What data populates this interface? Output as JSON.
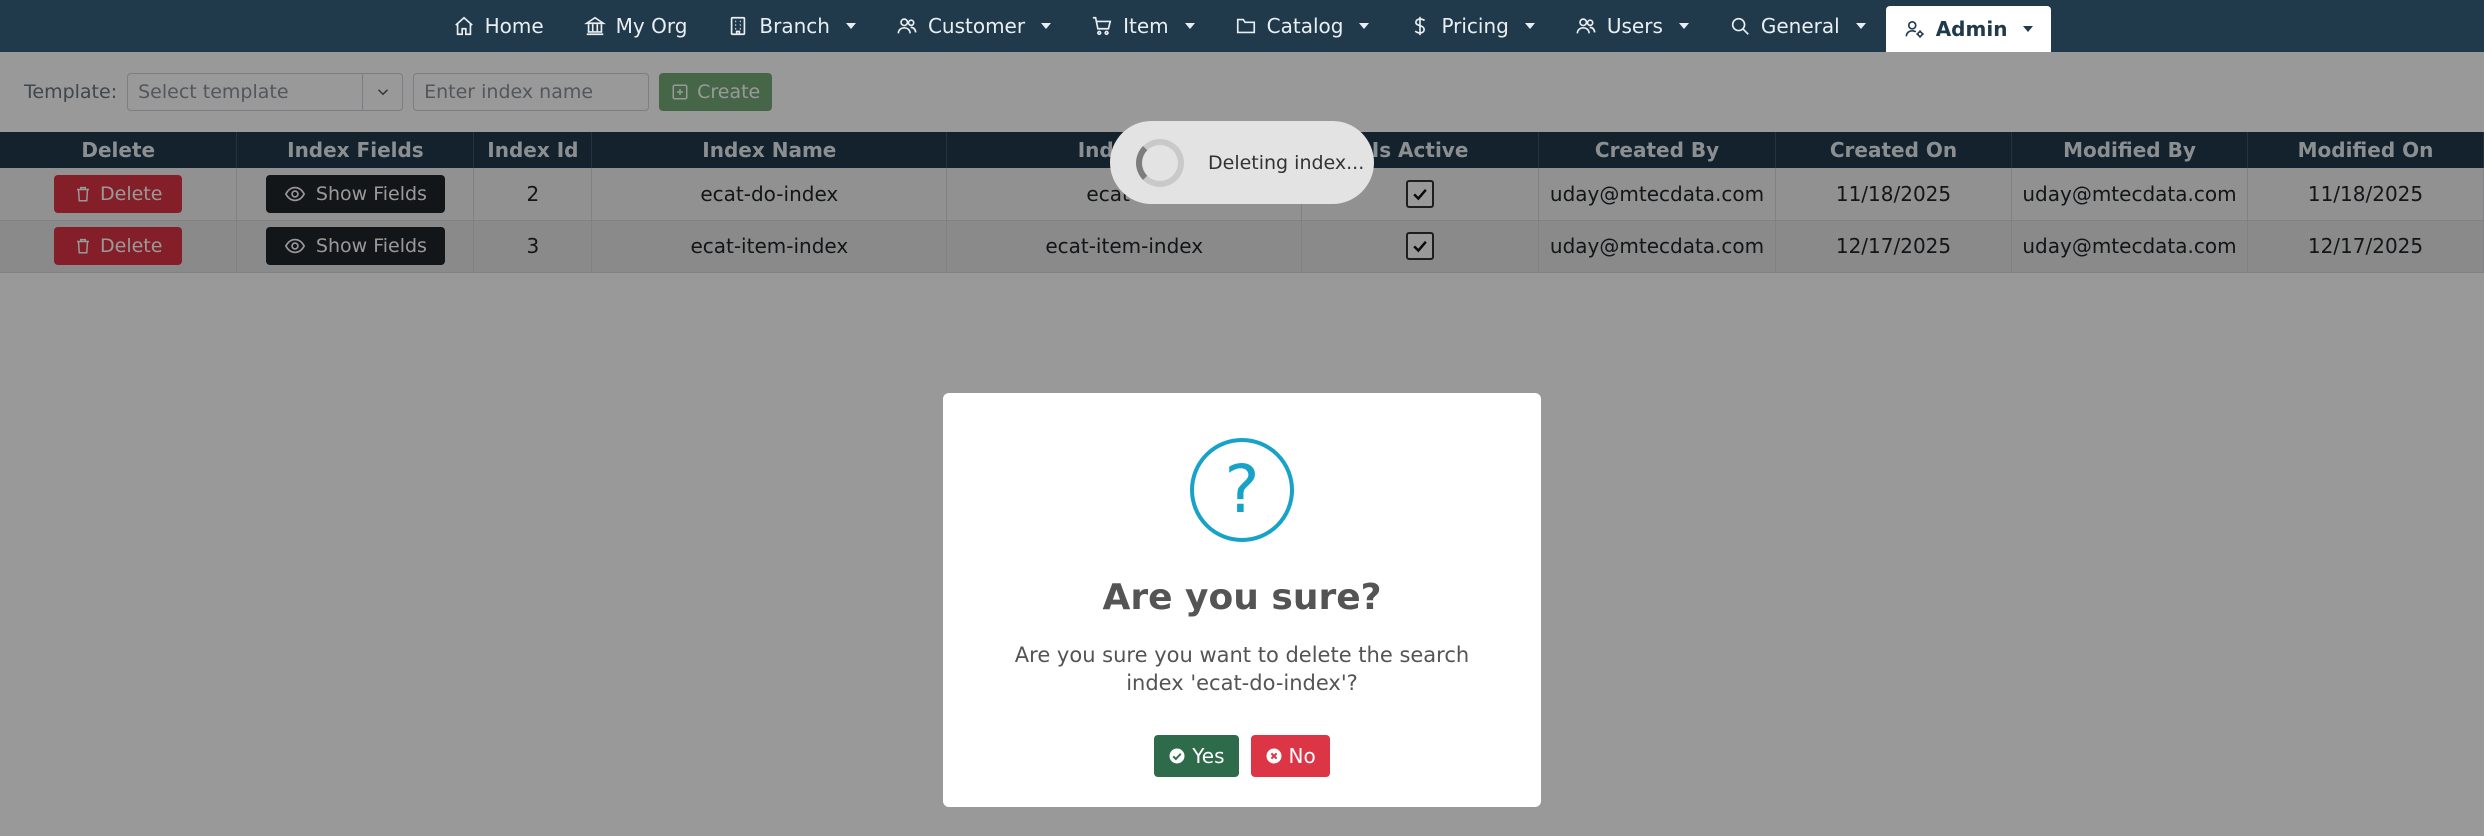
{
  "nav": {
    "items": [
      {
        "label": "Home",
        "icon": "home-icon",
        "has_dropdown": false
      },
      {
        "label": "My Org",
        "icon": "bank-icon",
        "has_dropdown": false
      },
      {
        "label": "Branch",
        "icon": "building-icon",
        "has_dropdown": true
      },
      {
        "label": "Customer",
        "icon": "users-icon",
        "has_dropdown": true
      },
      {
        "label": "Item",
        "icon": "cart-icon",
        "has_dropdown": true
      },
      {
        "label": "Catalog",
        "icon": "folder-icon",
        "has_dropdown": true
      },
      {
        "label": "Pricing",
        "icon": "dollar-icon",
        "has_dropdown": true
      },
      {
        "label": "Users",
        "icon": "users-icon",
        "has_dropdown": true
      },
      {
        "label": "General",
        "icon": "search-icon",
        "has_dropdown": true
      },
      {
        "label": "Admin",
        "icon": "user-gear-icon",
        "has_dropdown": true,
        "active": true
      }
    ]
  },
  "toolbar": {
    "template_label": "Template:",
    "template_placeholder": "Select template",
    "index_placeholder": "Enter index name",
    "create_label": "Create"
  },
  "table": {
    "headers": [
      "Delete",
      "Index Fields",
      "Index Id",
      "Index Name",
      "Index Di",
      "Is Active",
      "Created By",
      "Created On",
      "Modified By",
      "Modified On"
    ],
    "delete_label": "Delete",
    "show_fields_label": "Show Fields",
    "rows": [
      {
        "index_id": "2",
        "index_name": "ecat-do-index",
        "index_display": "ecat-do",
        "is_active": true,
        "created_by": "uday@mtecdata.com",
        "created_on": "11/18/2025",
        "modified_by": "uday@mtecdata.com",
        "modified_on": "11/18/2025"
      },
      {
        "index_id": "3",
        "index_name": "ecat-item-index",
        "index_display": "ecat-item-index",
        "is_active": true,
        "created_by": "uday@mtecdata.com",
        "created_on": "12/17/2025",
        "modified_by": "uday@mtecdata.com",
        "modified_on": "12/17/2025"
      }
    ]
  },
  "toast": {
    "message": "Deleting index..."
  },
  "dialog": {
    "icon_glyph": "?",
    "title": "Are you sure?",
    "message": "Are you sure you want to delete the search index 'ecat-do-index'?",
    "yes_label": "Yes",
    "no_label": "No"
  },
  "colors": {
    "navbar": "#203a4b",
    "danger": "#dc3545",
    "confirm": "#2e6b4a",
    "info_icon": "#17a2c8"
  }
}
